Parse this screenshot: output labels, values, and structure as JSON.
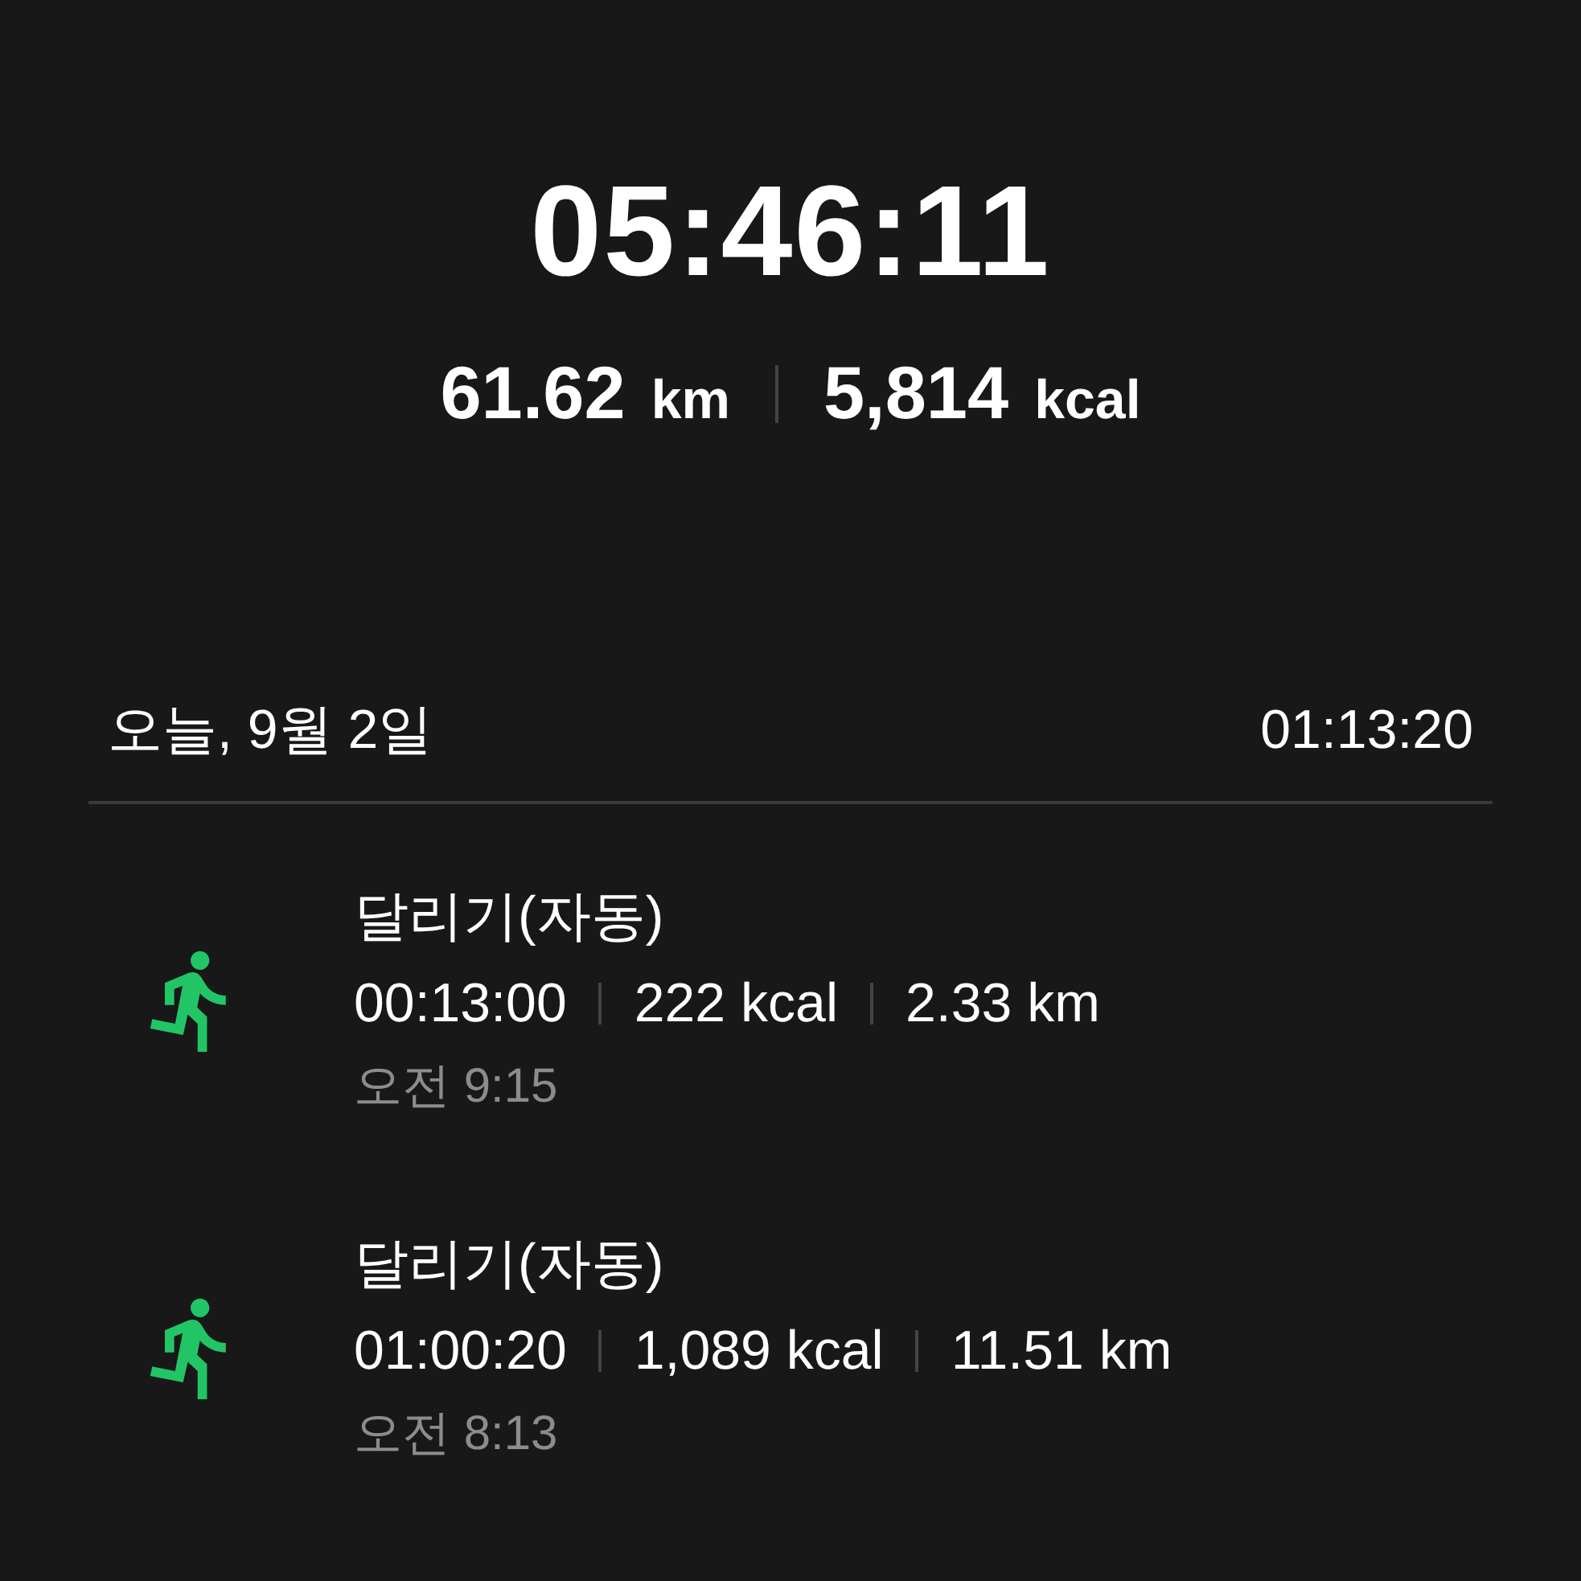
{
  "summary": {
    "duration": "05:46:11",
    "stats": [
      {
        "value": "61.62",
        "unit": "km"
      },
      {
        "value": "5,814",
        "unit": "kcal"
      }
    ]
  },
  "day": {
    "date": "오늘, 9월 2일",
    "total": "01:13:20"
  },
  "workouts": [
    {
      "name": "달리기(자동)",
      "metrics": [
        "00:13:00",
        "222 kcal",
        "2.33 km"
      ],
      "start": "오전 9:15"
    },
    {
      "name": "달리기(자동)",
      "metrics": [
        "01:00:20",
        "1,089 kcal",
        "11.51 km"
      ],
      "start": "오전 8:13"
    }
  ]
}
